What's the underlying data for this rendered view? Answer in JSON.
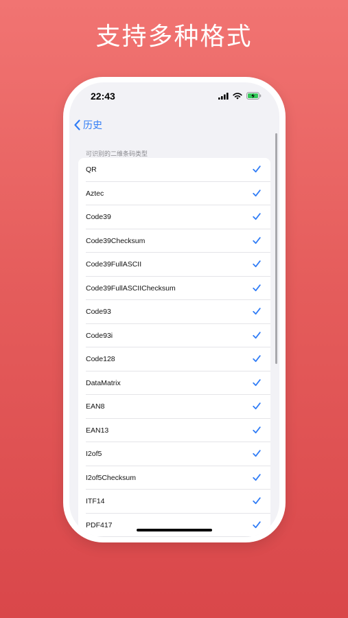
{
  "banner": {
    "headline": "支持多种格式"
  },
  "status_bar": {
    "time": "22:43",
    "icons": [
      "cellular-signal-icon",
      "wifi-icon",
      "battery-charging-icon"
    ]
  },
  "nav": {
    "back_label": "历史",
    "back_icon": "chevron-left-icon"
  },
  "section": {
    "header": "可识别的二维条码类型"
  },
  "formats": [
    {
      "label": "QR",
      "checked": true
    },
    {
      "label": "Aztec",
      "checked": true
    },
    {
      "label": "Code39",
      "checked": true
    },
    {
      "label": "Code39Checksum",
      "checked": true
    },
    {
      "label": "Code39FullASCII",
      "checked": true
    },
    {
      "label": "Code39FullASCIIChecksum",
      "checked": true
    },
    {
      "label": "Code93",
      "checked": true
    },
    {
      "label": "Code93i",
      "checked": true
    },
    {
      "label": "Code128",
      "checked": true
    },
    {
      "label": "DataMatrix",
      "checked": true
    },
    {
      "label": "EAN8",
      "checked": true
    },
    {
      "label": "EAN13",
      "checked": true
    },
    {
      "label": "I2of5",
      "checked": true
    },
    {
      "label": "I2of5Checksum",
      "checked": true
    },
    {
      "label": "ITF14",
      "checked": true
    },
    {
      "label": "PDF417",
      "checked": true
    }
  ],
  "colors": {
    "accent": "#2f7cf6",
    "background_top": "#f17472",
    "background_bottom": "#d9474a"
  }
}
